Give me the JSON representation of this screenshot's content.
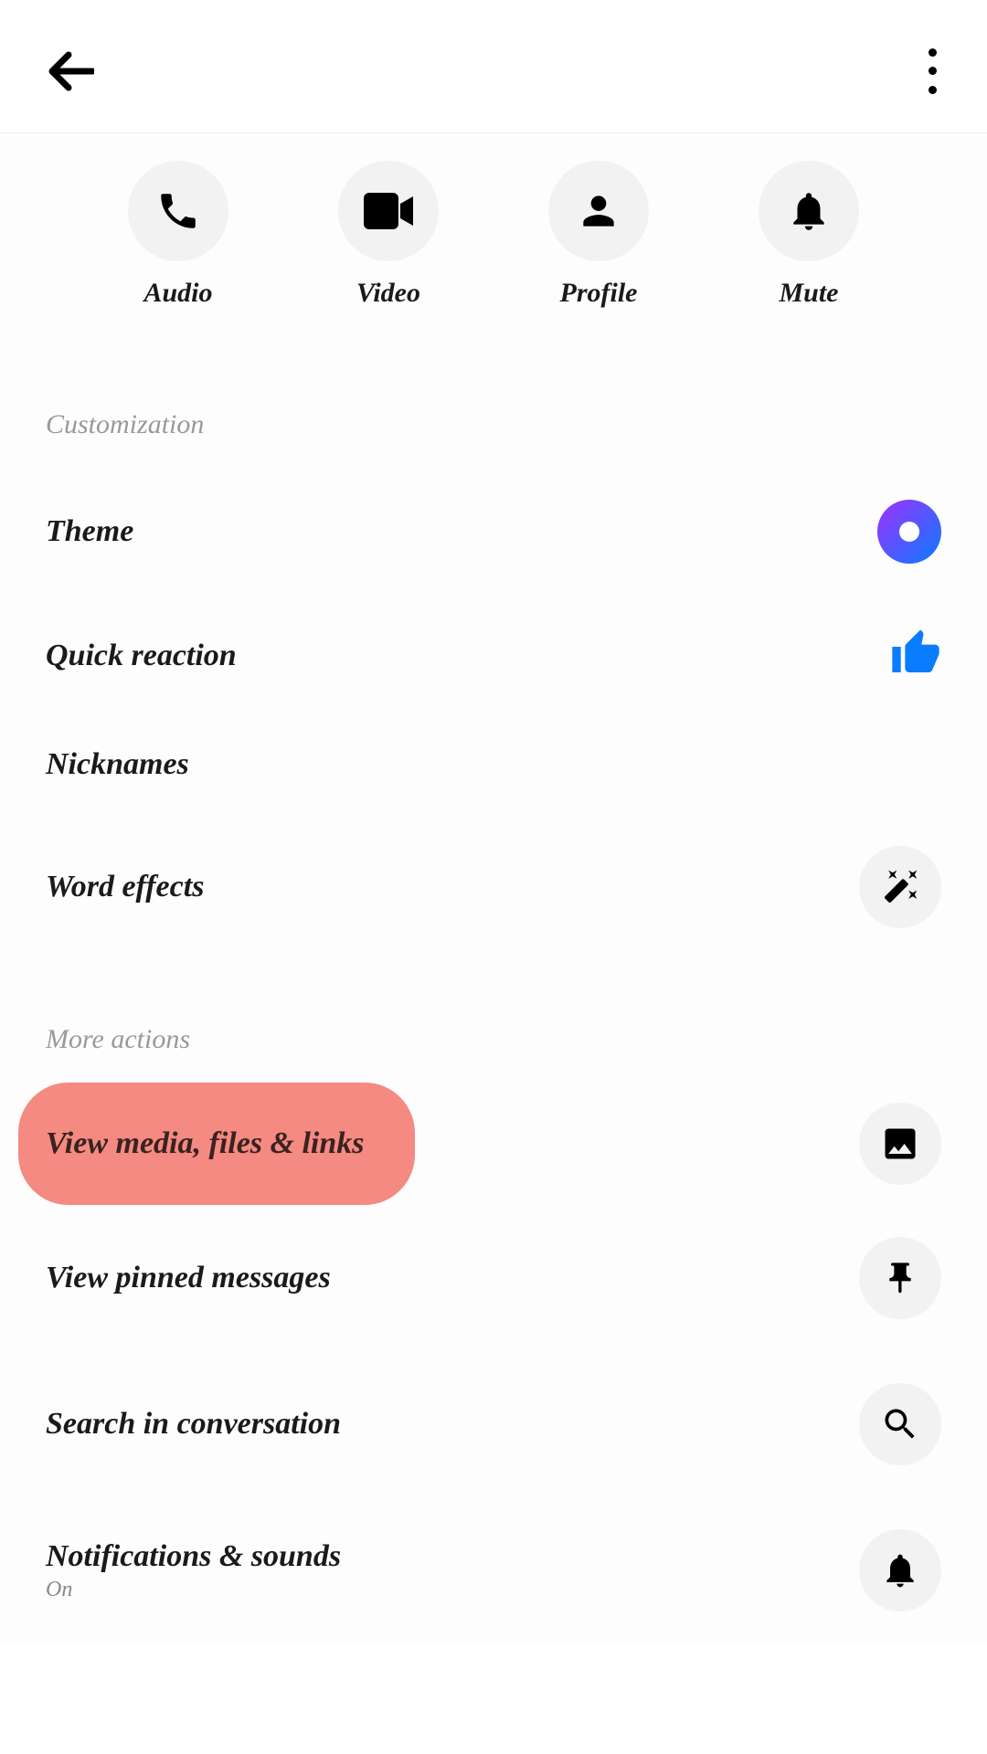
{
  "header": {},
  "actions": {
    "audio": "Audio",
    "video": "Video",
    "profile": "Profile",
    "mute": "Mute"
  },
  "sections": {
    "customization": "Customization",
    "more_actions": "More actions"
  },
  "customization_items": {
    "theme": "Theme",
    "quick_reaction": "Quick reaction",
    "nicknames": "Nicknames",
    "word_effects": "Word effects"
  },
  "more_actions_items": {
    "view_media": "View media, files & links",
    "view_pinned": "View pinned messages",
    "search": "Search in conversation",
    "notifications": "Notifications & sounds",
    "notifications_sub": "On"
  }
}
